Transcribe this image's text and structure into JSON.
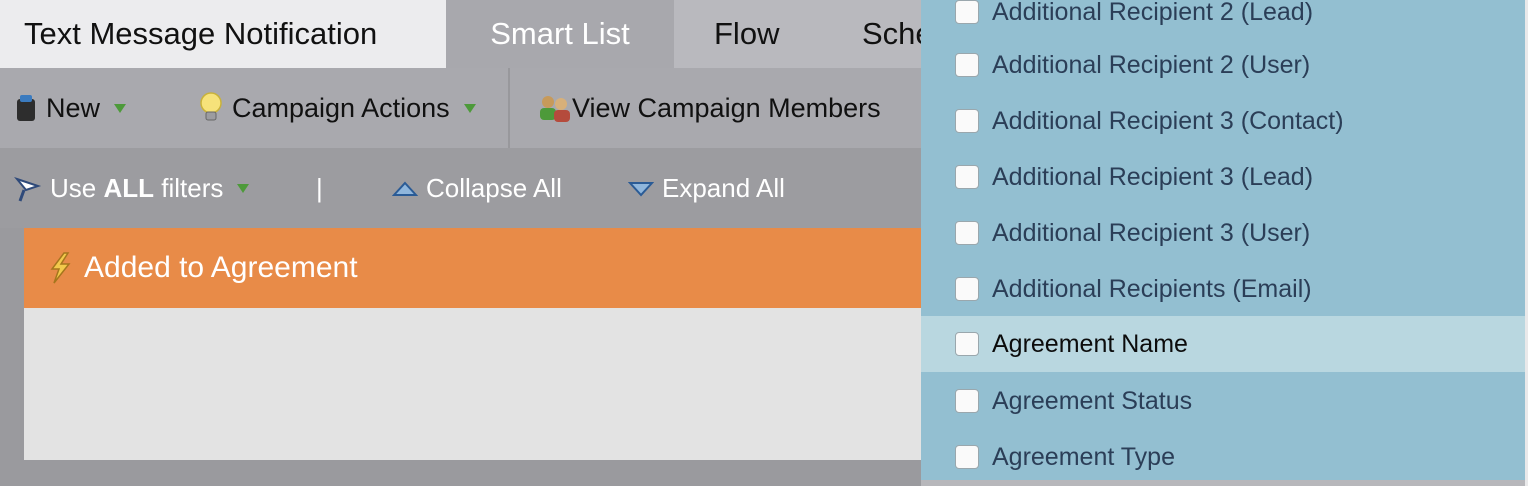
{
  "tabs": [
    {
      "label": "Text Message Notification"
    },
    {
      "label": "Smart List"
    },
    {
      "label": "Flow"
    },
    {
      "label": "Sche"
    }
  ],
  "toolbar": {
    "new_label": "New",
    "campaign_actions_label": "Campaign Actions",
    "view_members_label": "View Campaign Members"
  },
  "filters": {
    "use_prefix": "Use ",
    "use_bold": "ALL",
    "use_suffix": " filters",
    "separator": "|",
    "collapse_label": "Collapse All",
    "expand_label": "Expand All"
  },
  "filter_card": {
    "title": "Added to Agreement"
  },
  "dropdown": {
    "items": [
      {
        "label": "Additional Recipient 2 (Lead)",
        "checked": false
      },
      {
        "label": "Additional Recipient 2 (User)",
        "checked": false
      },
      {
        "label": "Additional Recipient 3 (Contact)",
        "checked": false
      },
      {
        "label": "Additional Recipient 3 (Lead)",
        "checked": false
      },
      {
        "label": "Additional Recipient 3 (User)",
        "checked": false
      },
      {
        "label": "Additional Recipients (Email)",
        "checked": false
      },
      {
        "label": "Agreement Name",
        "checked": false,
        "highlighted": true
      },
      {
        "label": "Agreement Status",
        "checked": false
      },
      {
        "label": "Agreement Type",
        "checked": false
      }
    ]
  },
  "colors": {
    "tab_active": "#a8a8ad",
    "card_header": "#e88b48",
    "dropdown_bg": "#93bfd1",
    "dropdown_highlight": "#b9d7e0"
  }
}
